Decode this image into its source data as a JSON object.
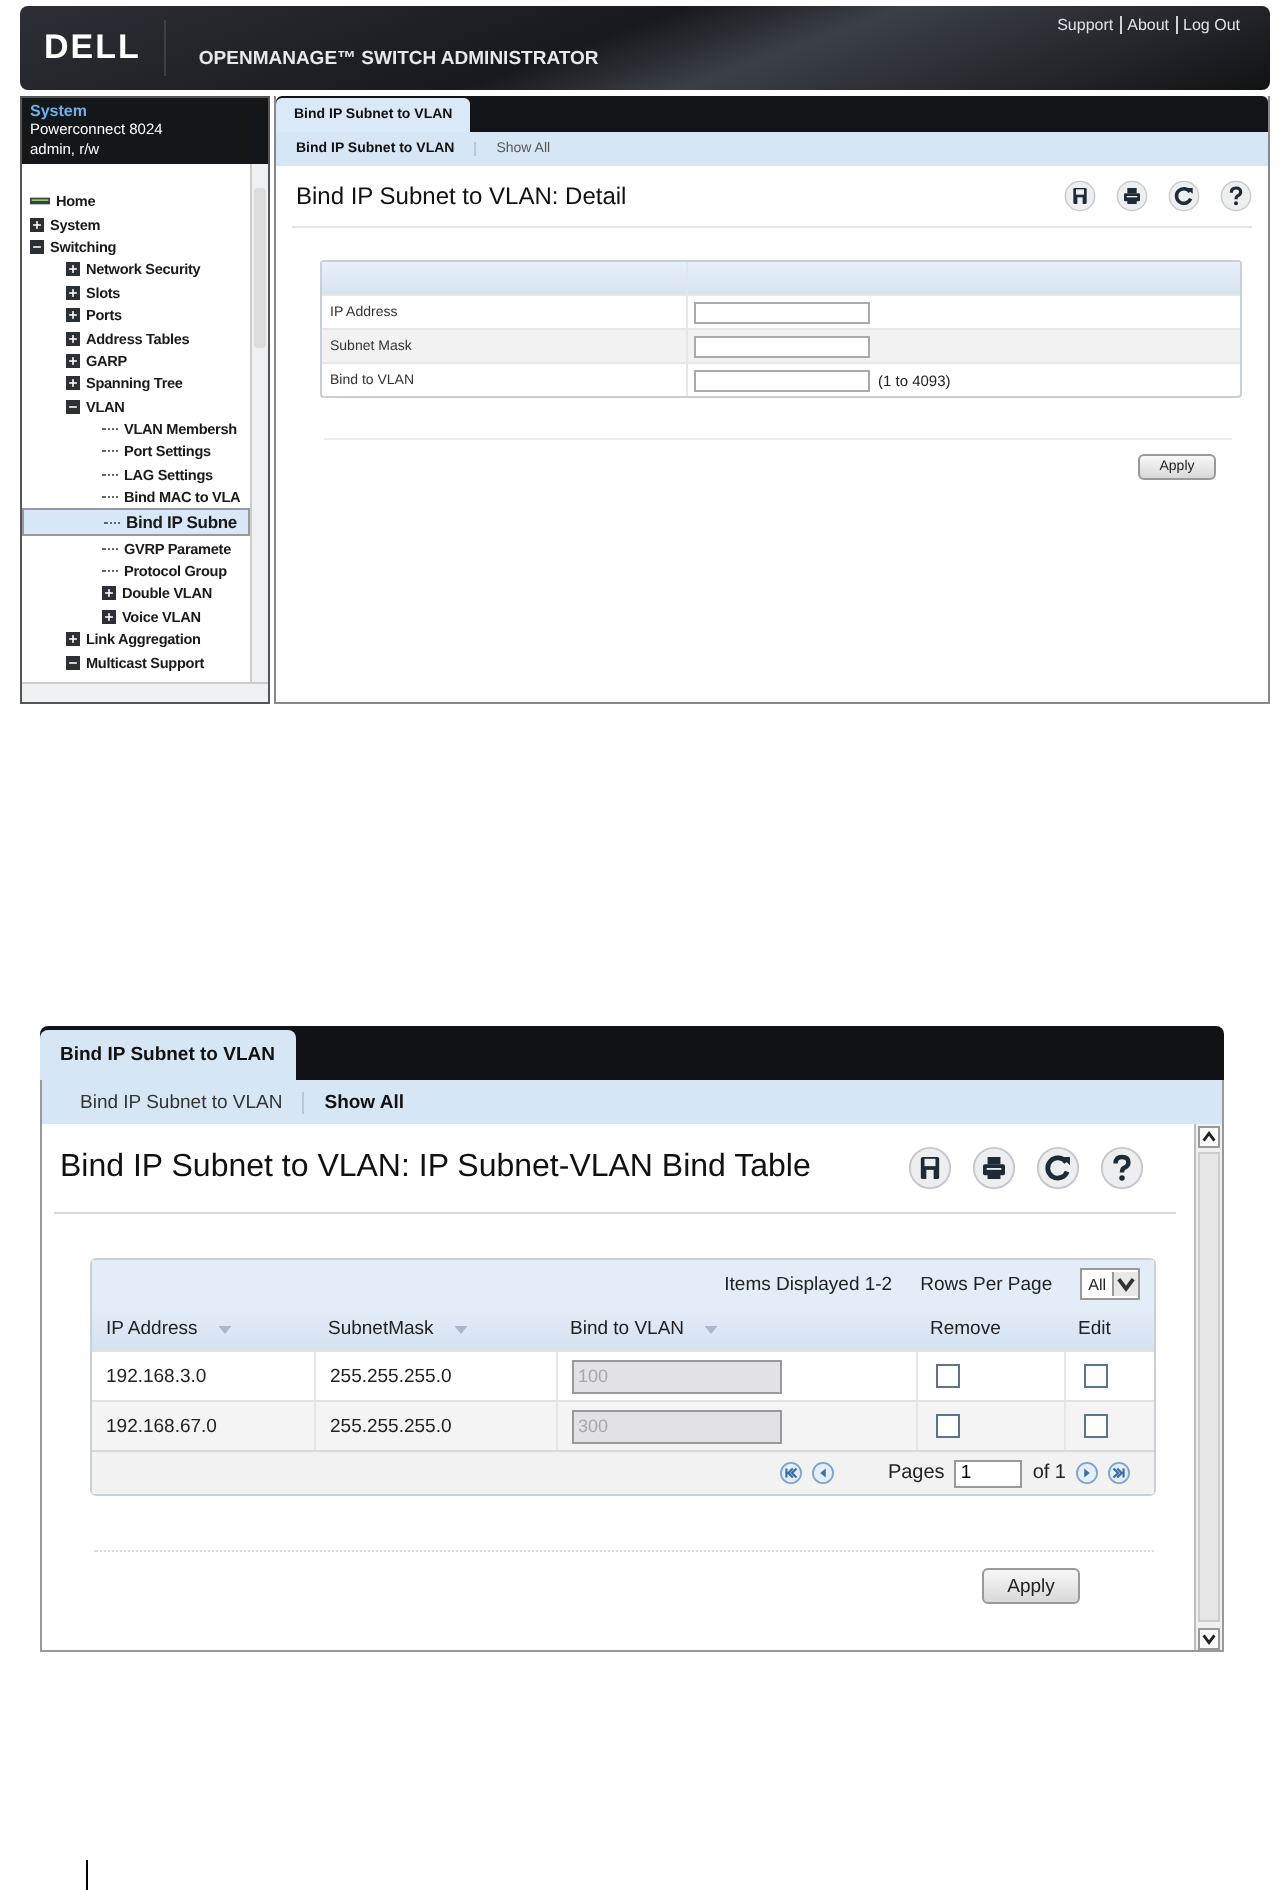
{
  "detail_screen": {
    "header": {
      "logo": "DELL",
      "title": "OPENMANAGE™ SWITCH ADMINISTRATOR",
      "links": [
        "Support",
        "About",
        "Log Out"
      ]
    },
    "sidebar": {
      "system_label": "System",
      "device": "Powerconnect 8024",
      "user": "admin, r/w",
      "tree": [
        {
          "label": "Home",
          "kind": "home",
          "selected": false
        },
        {
          "label": "System",
          "kind": "branch",
          "expanded": false,
          "selected": false
        },
        {
          "label": "Switching",
          "kind": "branch",
          "expanded": true,
          "selected": false,
          "children": [
            {
              "label": "Network Security",
              "kind": "branch",
              "expanded": false,
              "selected": false
            },
            {
              "label": "Slots",
              "kind": "branch",
              "expanded": false,
              "selected": false
            },
            {
              "label": "Ports",
              "kind": "branch",
              "expanded": false,
              "selected": false
            },
            {
              "label": "Address Tables",
              "kind": "branch",
              "expanded": false,
              "selected": false
            },
            {
              "label": "GARP",
              "kind": "branch",
              "expanded": false,
              "selected": false
            },
            {
              "label": "Spanning Tree",
              "kind": "branch",
              "expanded": false,
              "selected": false
            },
            {
              "label": "VLAN",
              "kind": "branch",
              "expanded": true,
              "selected": false,
              "children": [
                {
                  "label": "VLAN Membersh",
                  "kind": "leaf",
                  "selected": false
                },
                {
                  "label": "Port Settings",
                  "kind": "leaf",
                  "selected": false
                },
                {
                  "label": "LAG Settings",
                  "kind": "leaf",
                  "selected": false
                },
                {
                  "label": "Bind MAC to VLA",
                  "kind": "leaf",
                  "selected": false
                },
                {
                  "label": "Bind IP Subne",
                  "kind": "leaf",
                  "selected": true
                },
                {
                  "label": "GVRP Paramete",
                  "kind": "leaf",
                  "selected": false
                },
                {
                  "label": "Protocol Group",
                  "kind": "leaf",
                  "selected": false
                },
                {
                  "label": "Double VLAN",
                  "kind": "branch",
                  "expanded": false,
                  "selected": false
                },
                {
                  "label": "Voice VLAN",
                  "kind": "branch",
                  "expanded": false,
                  "selected": false
                }
              ]
            },
            {
              "label": "Link Aggregation",
              "kind": "branch",
              "expanded": false,
              "selected": false
            },
            {
              "label": "Multicast Support",
              "kind": "branch",
              "expanded": true,
              "selected": false
            }
          ]
        }
      ]
    },
    "tabs": [
      {
        "label": "Bind IP Subnet to VLAN",
        "selected": true
      }
    ],
    "subtabs": [
      {
        "label": "Bind IP Subnet to VLAN",
        "selected": true
      },
      {
        "label": "Show All",
        "selected": false
      }
    ],
    "heading": "Bind IP Subnet to VLAN: Detail",
    "form": {
      "fields": [
        {
          "label": "IP Address"
        },
        {
          "label": "Subnet Mask"
        },
        {
          "label": "Bind to VLAN",
          "hint": "(1 to 4093)"
        }
      ]
    },
    "apply_button": "Apply"
  },
  "table_screen": {
    "tabs": [
      {
        "label": "Bind IP Subnet to VLAN",
        "selected": true
      }
    ],
    "subtabs": [
      {
        "label": "Bind IP Subnet to VLAN",
        "selected": false
      },
      {
        "label": "Show All",
        "selected": true
      }
    ],
    "heading": "Bind IP Subnet to VLAN: IP Subnet-VLAN Bind Table",
    "table": {
      "items_displayed": "Items Displayed 1-2",
      "rows_per_page_label": "Rows Per Page",
      "rows_per_page": "All",
      "columns": [
        {
          "label": "IP Address",
          "sortable": true
        },
        {
          "label": "SubnetMask",
          "sortable": true
        },
        {
          "label": "Bind to VLAN",
          "sortable": true
        },
        {
          "label": "Remove",
          "sortable": false
        },
        {
          "label": "Edit",
          "sortable": false
        }
      ],
      "rows": [
        {
          "ip_address": "192.168.3.0",
          "subnet_mask": "255.255.255.0",
          "bind_to_vlan": "100",
          "vlan_disabled": true,
          "remove": false,
          "edit": false
        },
        {
          "ip_address": "192.168.67.0",
          "subnet_mask": "255.255.255.0",
          "bind_to_vlan": "300",
          "vlan_disabled": true,
          "remove": false,
          "edit": false
        }
      ],
      "pager": {
        "pages_label": "Pages",
        "page": "1",
        "of_label": "of 1"
      }
    },
    "apply_button": "Apply"
  }
}
